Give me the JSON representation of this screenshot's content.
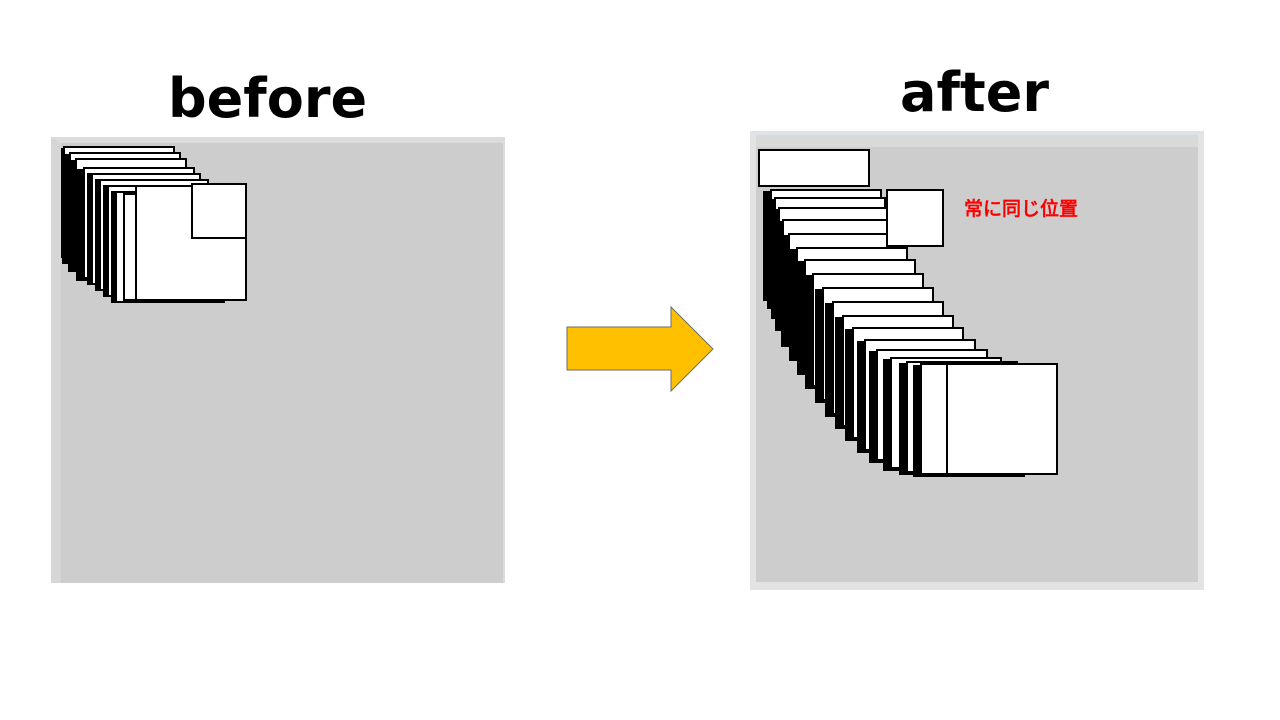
{
  "labels": {
    "before": "before",
    "after": "after",
    "note": "常に同じ位置"
  },
  "colors": {
    "panel_background": "#cdcdcd",
    "window_fill": "#ffffff",
    "window_border": "#000000",
    "arrow_fill": "#ffc000",
    "note_text": "#ff0000"
  },
  "icons": {
    "arrow": "right-arrow"
  }
}
